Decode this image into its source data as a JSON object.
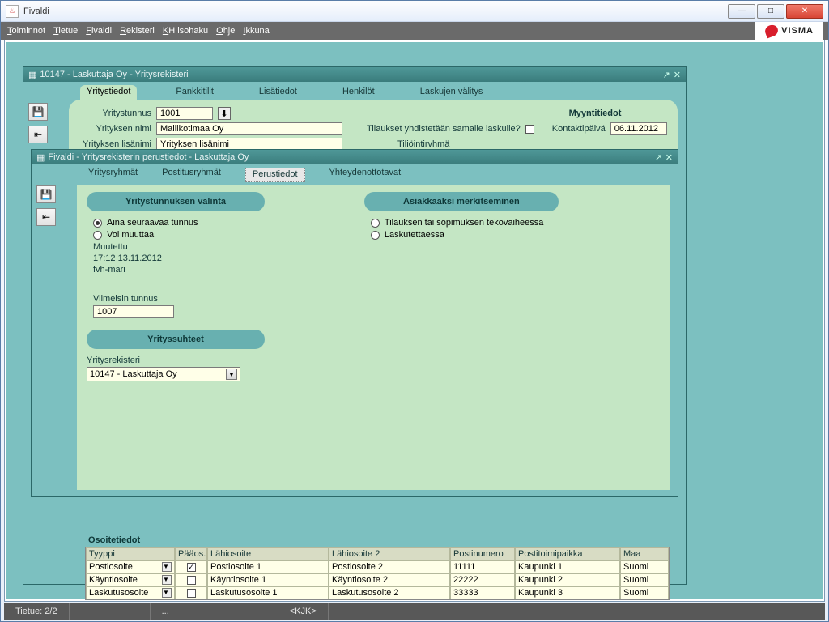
{
  "os_window": {
    "title": "Fivaldi"
  },
  "brand": "VISMA",
  "menubar": [
    "Toiminnot",
    "Tietue",
    "Fivaldi",
    "Rekisteri",
    "KH isohaku",
    "Ohje",
    "Ikkuna"
  ],
  "status": {
    "record": "Tietue: 2/2",
    "mid": "...",
    "user": "<KJK>"
  },
  "mdi_parent": {
    "title": "10147 - Laskuttaja Oy - Yritysrekisteri",
    "tabs": [
      "Yritystiedot",
      "Pankkitilit",
      "Lisätiedot",
      "Henkilöt",
      "Laskujen välitys"
    ],
    "active_tab": 0,
    "fields": {
      "yritystunnus_label": "Yritystunnus",
      "yritystunnus": "1001",
      "yrityksen_nimi_label": "Yrityksen nimi",
      "yrityksen_nimi": "Mallikotimaa Oy",
      "yrityksen_lisanimi_label": "Yrityksen lisänimi",
      "yrityksen_lisanimi": "Yrityksen lisänimi"
    },
    "myynti": {
      "title": "Myyntitiedot",
      "tilaukset_label": "Tilaukset yhdistetään samalle laskulle?",
      "tiliointi_label": "Tiliöintirvhmä",
      "kontakti_label": "Kontaktipäivä",
      "kontakti": "06.11.2012"
    }
  },
  "mdi_dialog": {
    "title": "Fivaldi - Yritysrekisterin perustiedot - Laskuttaja Oy",
    "tabs": [
      "Yritysryhmät",
      "Postitusryhmät",
      "Perustiedot",
      "Yhteydenottotavat"
    ],
    "active_tab": 2,
    "left": {
      "pill": "Yritystunnuksen valinta",
      "radio1": "Aina seuraavaa tunnus",
      "radio2": "Voi muuttaa",
      "muutettu_label": "Muutettu",
      "muutettu_time": "17:12 13.11.2012",
      "muutettu_user": "fvh-mari",
      "viimeisin_label": "Viimeisin tunnus",
      "viimeisin": "1007",
      "pill2": "Yrityssuhteet",
      "yritysrekisteri_label": "Yritysrekisteri",
      "yritysrekisteri": "10147 - Laskuttaja Oy"
    },
    "right": {
      "pill": "Asiakkaaksi merkitseminen",
      "radio1": "Tilauksen tai sopimuksen tekovaiheessa",
      "radio2": "Laskutettaessa"
    }
  },
  "addresses": {
    "section": "Osoitetiedot",
    "headers": [
      "Tyyppi",
      "Pääos.",
      "Lähiosoite",
      "Lähiosoite 2",
      "Postinumero",
      "Postitoimipaikka",
      "Maa"
    ],
    "rows": [
      {
        "tyyppi": "Postiosoite",
        "paaos": true,
        "lahi": "Postiosoite 1",
        "lahi2": "Postiosoite 2",
        "pn": "11111",
        "ptp": "Kaupunki 1",
        "maa": "Suomi"
      },
      {
        "tyyppi": "Käyntiosoite",
        "paaos": false,
        "lahi": "Käyntiosoite 1",
        "lahi2": "Käyntiosoite 2",
        "pn": "22222",
        "ptp": "Kaupunki 2",
        "maa": "Suomi"
      },
      {
        "tyyppi": "Laskutusosoite",
        "paaos": false,
        "lahi": "Laskutusosoite 1",
        "lahi2": "Laskutusosoite 2",
        "pn": "33333",
        "ptp": "Kaupunki 3",
        "maa": "Suomi"
      }
    ]
  }
}
